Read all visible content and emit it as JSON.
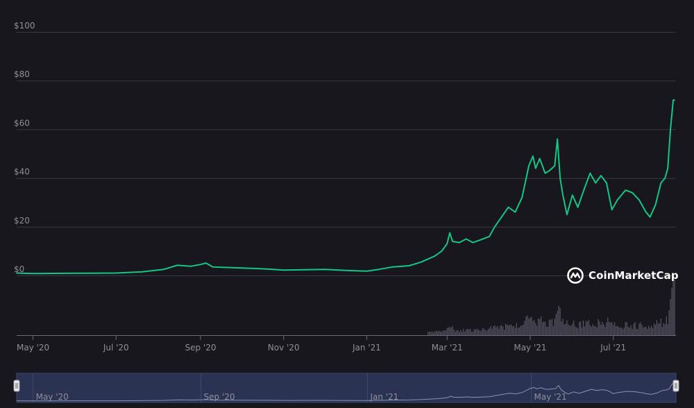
{
  "brand": {
    "name": "CoinMarketCap"
  },
  "colors": {
    "background": "#17171d",
    "line": "#16c784",
    "grid": "#3a3a44",
    "axis_text": "#8f8f9a",
    "volume": "#5a5866",
    "navigator_fill": "#2a3352",
    "navigator_border": "#3d4a70",
    "navigator_line": "#8a93b8"
  },
  "chart_data": {
    "type": "line",
    "x_scale": "date",
    "x_range": [
      "2020-04-19",
      "2021-08-15"
    ],
    "ylim": [
      0,
      100
    ],
    "y_ticks": [
      0,
      20,
      40,
      60,
      80,
      100
    ],
    "y_tick_labels": [
      "$0",
      "$20",
      "$40",
      "$60",
      "$80",
      "$100"
    ],
    "x_ticks": [
      "2020-05-01",
      "2020-07-01",
      "2020-09-01",
      "2020-11-01",
      "2021-01-01",
      "2021-03-01",
      "2021-05-01",
      "2021-07-01"
    ],
    "x_tick_labels": [
      "May '20",
      "Jul '20",
      "Sep '20",
      "Nov '20",
      "Jan '21",
      "Mar '21",
      "May '21",
      "Jul '21"
    ],
    "grid": true,
    "series": [
      {
        "points": [
          [
            "2020-04-19",
            1.0
          ],
          [
            "2020-05-01",
            0.8
          ],
          [
            "2020-06-01",
            0.9
          ],
          [
            "2020-07-01",
            1.0
          ],
          [
            "2020-07-20",
            1.5
          ],
          [
            "2020-08-05",
            2.5
          ],
          [
            "2020-08-15",
            4.2
          ],
          [
            "2020-08-25",
            3.8
          ],
          [
            "2020-09-01",
            4.5
          ],
          [
            "2020-09-05",
            5.1
          ],
          [
            "2020-09-10",
            3.5
          ],
          [
            "2020-09-25",
            3.2
          ],
          [
            "2020-10-15",
            2.8
          ],
          [
            "2020-11-01",
            2.2
          ],
          [
            "2020-12-01",
            2.5
          ],
          [
            "2020-12-20",
            2.0
          ],
          [
            "2021-01-01",
            1.8
          ],
          [
            "2021-01-10",
            2.5
          ],
          [
            "2021-01-20",
            3.5
          ],
          [
            "2021-02-01",
            4.0
          ],
          [
            "2021-02-10",
            5.5
          ],
          [
            "2021-02-20",
            8.0
          ],
          [
            "2021-02-25",
            10.0
          ],
          [
            "2021-03-01",
            13.0
          ],
          [
            "2021-03-03",
            17.5
          ],
          [
            "2021-03-05",
            14.0
          ],
          [
            "2021-03-10",
            13.5
          ],
          [
            "2021-03-15",
            15.0
          ],
          [
            "2021-03-20",
            13.5
          ],
          [
            "2021-03-25",
            14.5
          ],
          [
            "2021-04-01",
            16.0
          ],
          [
            "2021-04-05",
            20.0
          ],
          [
            "2021-04-10",
            24.0
          ],
          [
            "2021-04-15",
            28.0
          ],
          [
            "2021-04-20",
            26.0
          ],
          [
            "2021-04-25",
            32.0
          ],
          [
            "2021-04-30",
            45.0
          ],
          [
            "2021-05-03",
            49.0
          ],
          [
            "2021-05-05",
            44.0
          ],
          [
            "2021-05-08",
            48.0
          ],
          [
            "2021-05-12",
            42.0
          ],
          [
            "2021-05-15",
            43.0
          ],
          [
            "2021-05-19",
            45.0
          ],
          [
            "2021-05-21",
            56.0
          ],
          [
            "2021-05-23",
            40.0
          ],
          [
            "2021-05-25",
            33.0
          ],
          [
            "2021-05-28",
            25.0
          ],
          [
            "2021-06-01",
            33.0
          ],
          [
            "2021-06-05",
            28.0
          ],
          [
            "2021-06-10",
            36.0
          ],
          [
            "2021-06-14",
            42.0
          ],
          [
            "2021-06-18",
            38.0
          ],
          [
            "2021-06-22",
            41.0
          ],
          [
            "2021-06-26",
            38.0
          ],
          [
            "2021-06-30",
            27.0
          ],
          [
            "2021-07-04",
            31.0
          ],
          [
            "2021-07-10",
            35.0
          ],
          [
            "2021-07-15",
            34.0
          ],
          [
            "2021-07-20",
            31.0
          ],
          [
            "2021-07-25",
            26.0
          ],
          [
            "2021-07-28",
            24.0
          ],
          [
            "2021-08-01",
            29.0
          ],
          [
            "2021-08-05",
            38.0
          ],
          [
            "2021-08-08",
            40.0
          ],
          [
            "2021-08-10",
            44.0
          ],
          [
            "2021-08-12",
            60.0
          ],
          [
            "2021-08-14",
            72.0
          ],
          [
            "2021-08-15",
            72.0
          ]
        ]
      }
    ],
    "volume_bars_present": true,
    "navigator": {
      "x_tick_labels": [
        "May '20",
        "Sep '20",
        "Jan '21",
        "May '21"
      ],
      "x_ticks": [
        "2020-05-01",
        "2020-09-01",
        "2021-01-01",
        "2021-05-01"
      ]
    }
  }
}
